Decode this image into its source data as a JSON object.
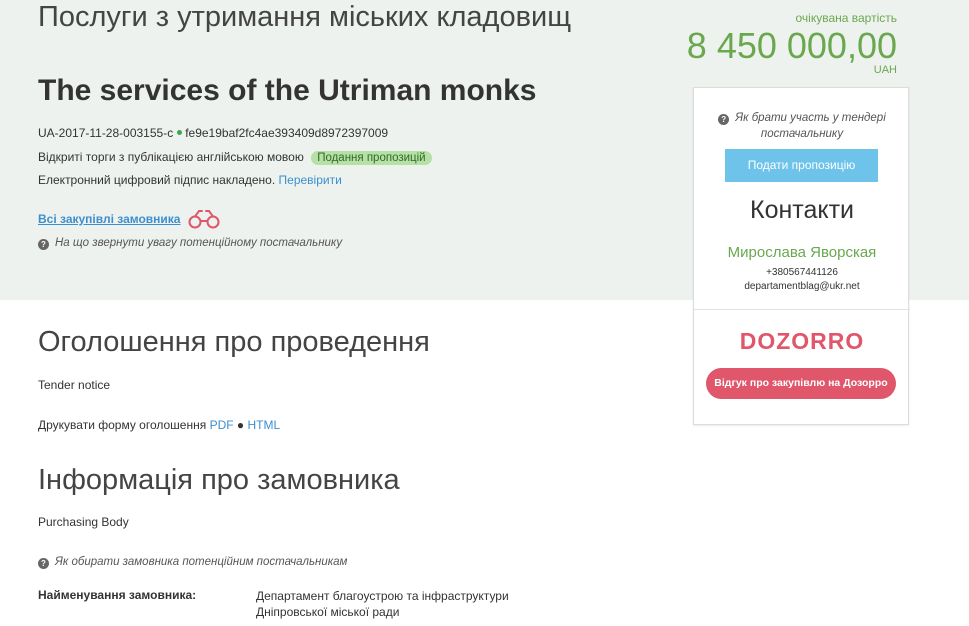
{
  "tender": {
    "title_ua": "Послуги з утримання міських кладовищ",
    "title_en": "The services of the Utriman monks",
    "tender_id": "UA-2017-11-28-003155-c",
    "hash": "fe9e19baf2fc4ae393409d8972397009",
    "procedure_type": "Відкриті торги з публікацією англійською мовою",
    "status": "Подання пропозицій",
    "signature_text": "Електронний цифровий підпис накладено.",
    "signature_link": "Перевірити",
    "all_purchases_link": "Всі закупівлі замовника",
    "attention_hint": "На що звернути увагу потенційному постачальнику"
  },
  "value": {
    "label": "очікувана вартість",
    "amount": "8 450 000,00",
    "currency": "UAH"
  },
  "sidebar": {
    "participation_hint": "Як брати участь у тендері постачальнику",
    "submit_button": "Подати пропозицію",
    "contacts_title": "Контакти",
    "contact_name": "Мирослава Яворская",
    "contact_phone": "+380567441126",
    "contact_email": "departamentblag@ukr.net",
    "dozorro_logo": "DOZORRO",
    "dozorro_button": "Відгук про закупівлю на Дозорро"
  },
  "notice_section": {
    "title": "Оголошення про проведення",
    "subtitle": "Tender notice",
    "print_label": "Друкувати форму оголошення",
    "pdf_link": "PDF",
    "html_link": "HTML"
  },
  "buyer_section": {
    "title": "Інформація про замовника",
    "subtitle": "Purchasing Body",
    "hint": "Як обирати замовника потенційним постачальникам",
    "name_label": "Найменування замовника:",
    "name_value": "Департамент благоустрою та інфраструктури Дніпровської міської ради"
  },
  "colors": {
    "accent_green": "#6aa84f",
    "link_blue": "#3b8fd0",
    "button_blue": "#6ec3ea",
    "dozorro_pink": "#e0566a",
    "hero_bg": "#eef2ee"
  }
}
